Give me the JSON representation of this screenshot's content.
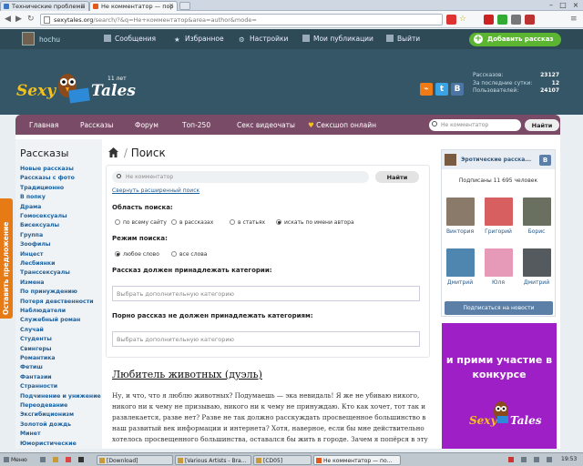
{
  "browser": {
    "tabs": [
      {
        "title": "Технические проблемы",
        "active": false
      },
      {
        "title": "Не комментатор — пор",
        "active": true
      }
    ],
    "url_host": "sexytales.org",
    "url_path": "/search/?&q=Не+комментатор&area=author&mode="
  },
  "header": {
    "username": "hochu",
    "menu": [
      "Сообщения",
      "Избранное",
      "Настройки",
      "Мои публикации",
      "Выйти"
    ],
    "add_story": "Добавить рассказ"
  },
  "logo": {
    "text1": "Sexy",
    "text2": "Tales",
    "years": "11 лет"
  },
  "stats": [
    {
      "label": "Рассказов:",
      "value": "23127"
    },
    {
      "label": "За последние сутки:",
      "value": "12"
    },
    {
      "label": "Пользователей:",
      "value": "24107"
    }
  ],
  "nav": {
    "items": [
      "Главная",
      "Рассказы",
      "Форум",
      "Топ-250",
      "Секс видеочаты",
      "Сексшоп онлайн"
    ],
    "search_placeholder": "Не комментатор",
    "find": "Найти"
  },
  "sidebar": {
    "title": "Рассказы",
    "categories": [
      "Новые рассказы",
      "Рассказы с фото",
      "Традиционно",
      "В попку",
      "Драма",
      "Гомосексуалы",
      "Бисексуалы",
      "Группа",
      "Зоофилы",
      "Инцест",
      "Лесбиянки",
      "Транссексуалы",
      "Измена",
      "По принуждению",
      "Потеря девственности",
      "Наблюдатели",
      "Служебный роман",
      "Случай",
      "Студенты",
      "Свингеры",
      "Романтика",
      "Фетиш",
      "Фантазии",
      "Странности",
      "Подчинение и унижение",
      "Переодевание",
      "Эксгибиционизм",
      "Золотой дождь",
      "Минет",
      "Юмористические"
    ],
    "side_tab": "Оставить предложение"
  },
  "search": {
    "breadcrumb": "Поиск",
    "input_value": "Не комментатор",
    "find": "Найти",
    "collapse": "Свернуть расширенный поиск",
    "area_label": "Область поиска:",
    "area_options": [
      "по всему сайту",
      "в рассказах",
      "в статьях",
      "искать по имени автора"
    ],
    "area_selected": 3,
    "mode_label": "Режим поиска:",
    "mode_options": [
      "любое слово",
      "все слова"
    ],
    "mode_selected": 0,
    "include_label": "Рассказ должен принадлежать категории:",
    "include_placeholder": "Выбрать дополнительную категорию",
    "exclude_label": "Порно рассказ не должен принадлежать категориям:",
    "exclude_placeholder": "Выбрать дополнительную категорию"
  },
  "story": {
    "title": "Любитель животных (дуэль)",
    "body": "Ну, и что, что я люблю животных? Подумаешь — эка невидаль! Я же не убиваю никого, никого ни к чему не призываю, никого ни к чему не принуждаю. Кто как хочет, тот так и развлекается, разве нет? Разве не так должно расскуждать просвещенное большинство в наш развитый век информации и интернета? Хотя, наверное, если бы мне действительно хотелось просвещенного большинства, оставался бы жить в городе. Зачем я попёрся в эту тьмутаракань — в прямом и"
  },
  "vk_widget": {
    "title": "Эротические расска...",
    "logo": "В",
    "subscribers": "Подписаны 11 695 человек",
    "members": [
      "Виктория",
      "Григорий",
      "Борис",
      "Дмитрий",
      "Юля",
      "Дмитрий"
    ],
    "subscribe": "Подписаться на новости"
  },
  "promo": {
    "text": "и прими участие в конкурсе",
    "logo1": "Sexy",
    "logo2": "Tales"
  },
  "taskbar": {
    "start": "Меню",
    "tasks": [
      "[Download]",
      "[Various Artists - Bra...",
      "[CD05]",
      "Не комментатор — по..."
    ],
    "clock": "19:53"
  },
  "colors": {
    "nav": "#7a4b66",
    "add_button": "#5cb531",
    "side_tab": "#e67a14",
    "promo": "#9f1fc7",
    "link": "#1b5f9b"
  }
}
